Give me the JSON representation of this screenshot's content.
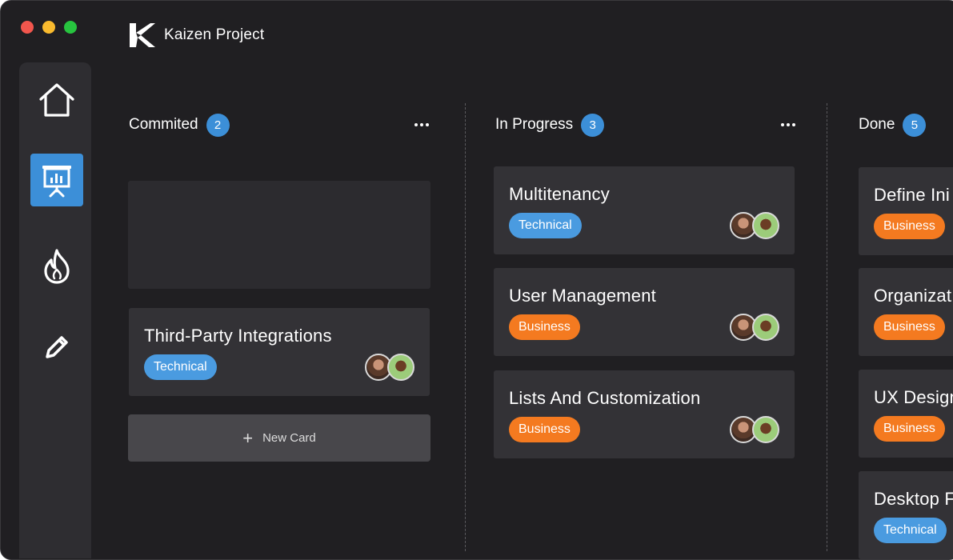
{
  "app": {
    "title": "Kaizen Project"
  },
  "sidebar": {
    "items": [
      {
        "icon": "home-icon",
        "active": false
      },
      {
        "icon": "presentation-board-icon",
        "active": true
      },
      {
        "icon": "flame-icon",
        "active": false
      },
      {
        "icon": "pencil-icon",
        "active": false
      }
    ]
  },
  "columns": [
    {
      "title": "Commited",
      "count": "2",
      "cards": [
        {
          "title": "Third-Party Integrations",
          "tag": "Technical"
        }
      ],
      "new_card_label": "New Card"
    },
    {
      "title": "In Progress",
      "count": "3",
      "cards": [
        {
          "title": "Multitenancy",
          "tag": "Technical"
        },
        {
          "title": "User Management",
          "tag": "Business"
        },
        {
          "title": "Lists And Customization",
          "tag": "Business"
        }
      ]
    },
    {
      "title": "Done",
      "count": "5",
      "cards": [
        {
          "title": "Define Ini",
          "tag": "Business"
        },
        {
          "title": "Organizat",
          "tag": "Business"
        },
        {
          "title": "UX Design",
          "tag": "Business"
        },
        {
          "title": "Desktop F",
          "tag": "Technical"
        }
      ]
    }
  ],
  "colors": {
    "background": "#201f22",
    "sidebar": "#2e2d31",
    "card": "#333236",
    "accent_blue": "#3c8fd8",
    "tag_technical": "#4a9be0",
    "tag_business": "#f47a20"
  }
}
